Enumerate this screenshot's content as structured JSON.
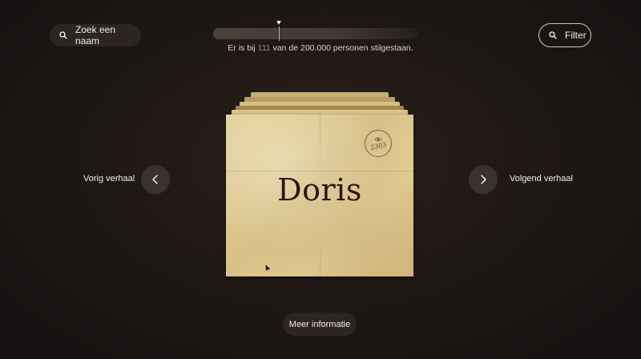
{
  "search": {
    "label": "Zoek een naam",
    "icon": "search-icon"
  },
  "filter": {
    "label": "Filter",
    "icon": "search-icon"
  },
  "status": {
    "prefix": "Er is bij",
    "count": "111",
    "suffix": "van de 200.000 personen stilgestaan."
  },
  "nav": {
    "prev_label": "Vorig verhaal",
    "next_label": "Volgend verhaal",
    "prev_icon": "chevron-left-icon",
    "next_icon": "chevron-right-icon"
  },
  "card": {
    "name": "Doris",
    "stamp_number": "2303",
    "stamp_icon": "eye-icon"
  },
  "more_button": {
    "label": "Meer informatie"
  },
  "colors": {
    "background": "#1f1814",
    "card": "#dcc68e",
    "name_text": "#2c1608",
    "pill_bg": "#2d2522",
    "highlight": "#9b8f98"
  }
}
